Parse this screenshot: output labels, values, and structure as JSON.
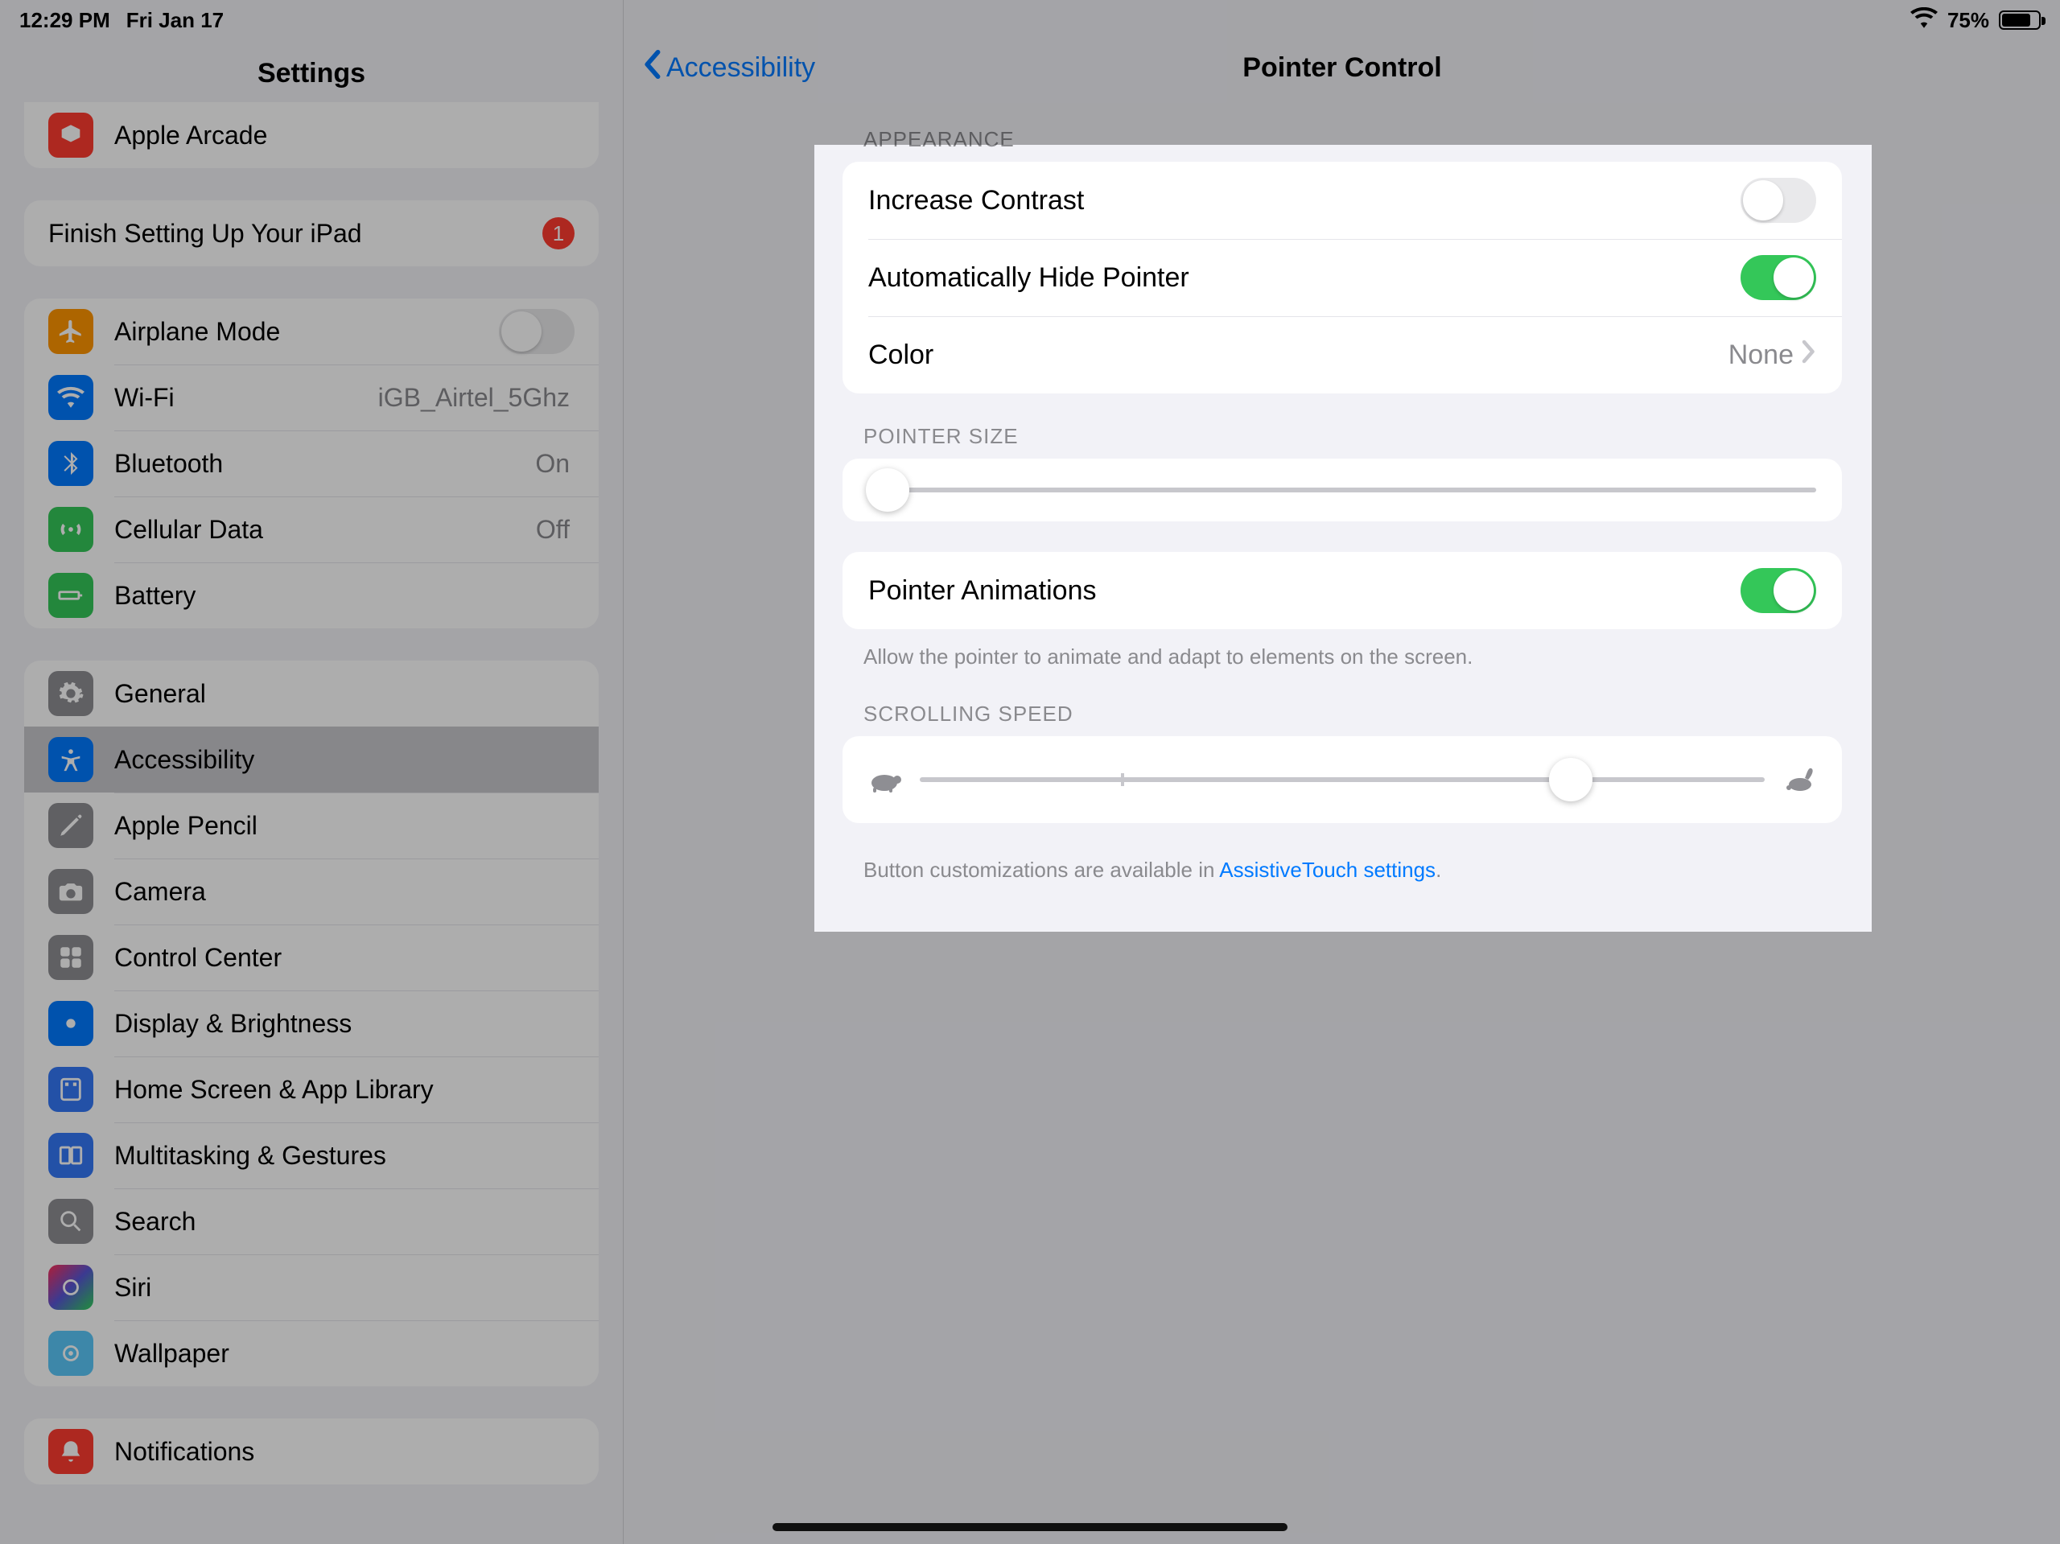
{
  "status": {
    "time": "12:29 PM",
    "date": "Fri Jan 17",
    "battery": "75%"
  },
  "sidebar": {
    "title": "Settings",
    "arcade": "Apple Arcade",
    "finish_setup": "Finish Setting Up Your iPad",
    "finish_badge": "1",
    "airplane": "Airplane Mode",
    "wifi": {
      "label": "Wi-Fi",
      "value": "iGB_Airtel_5Ghz"
    },
    "bluetooth": {
      "label": "Bluetooth",
      "value": "On"
    },
    "cellular": {
      "label": "Cellular Data",
      "value": "Off"
    },
    "battery": "Battery",
    "general": "General",
    "accessibility": "Accessibility",
    "pencil": "Apple Pencil",
    "camera": "Camera",
    "control_center": "Control Center",
    "display": "Display & Brightness",
    "home_screen": "Home Screen & App Library",
    "multitasking": "Multitasking & Gestures",
    "search": "Search",
    "siri": "Siri",
    "wallpaper": "Wallpaper",
    "notifications": "Notifications"
  },
  "detail": {
    "back": "Accessibility",
    "title": "Pointer Control",
    "appearance_header": "APPEARANCE",
    "increase_contrast": "Increase Contrast",
    "auto_hide": "Automatically Hide Pointer",
    "color": {
      "label": "Color",
      "value": "None"
    },
    "pointer_size_header": "POINTER SIZE",
    "pointer_animations": "Pointer Animations",
    "animations_footer": "Allow the pointer to animate and adapt to elements on the screen.",
    "scrolling_header": "SCROLLING SPEED",
    "bottom_footer_pre": "Button customizations are available in ",
    "bottom_footer_link": "AssistiveTouch settings",
    "bottom_footer_post": "."
  },
  "toggles": {
    "increase_contrast": false,
    "auto_hide": true,
    "pointer_animations": true,
    "airplane": false
  },
  "sliders": {
    "pointer_size_pct": 2,
    "scrolling_speed_pct": 77,
    "scrolling_tick_pct": 24
  }
}
